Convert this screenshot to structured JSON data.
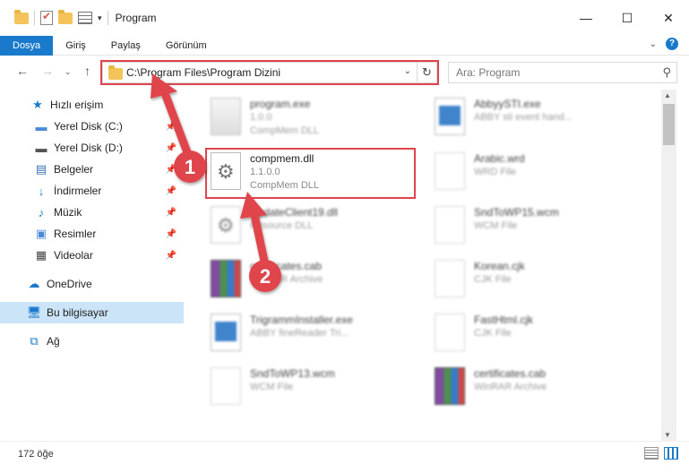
{
  "window": {
    "title": "Program",
    "qa_dropdown_glyph": "▾",
    "minimize": "—",
    "maximize": "☐",
    "close": "✕"
  },
  "ribbon": {
    "tabs": [
      "Dosya",
      "Giriş",
      "Paylaş",
      "Görünüm"
    ],
    "active_tab": "Dosya",
    "help": "?"
  },
  "address": {
    "path": "C:\\Program Files\\Program Dizini",
    "search_placeholder": "Ara: Program"
  },
  "sidebar": {
    "items": [
      {
        "label": "Hızlı erişim",
        "icon": "star-icon",
        "pinned": false
      },
      {
        "label": "Yerel Disk (C:)",
        "icon": "drive-icon",
        "pinned": true
      },
      {
        "label": "Yerel Disk (D:)",
        "icon": "drive-icon",
        "pinned": true
      },
      {
        "label": "Belgeler",
        "icon": "documents-icon",
        "pinned": true
      },
      {
        "label": "İndirmeler",
        "icon": "download-icon",
        "pinned": true
      },
      {
        "label": "Müzik",
        "icon": "music-icon",
        "pinned": true
      },
      {
        "label": "Resimler",
        "icon": "pictures-icon",
        "pinned": true
      },
      {
        "label": "Videolar",
        "icon": "video-icon",
        "pinned": true
      },
      {
        "label": "OneDrive",
        "icon": "cloud-icon",
        "pinned": false
      },
      {
        "label": "Bu bilgisayar",
        "icon": "computer-icon",
        "pinned": false
      },
      {
        "label": "Ağ",
        "icon": "network-icon",
        "pinned": false
      }
    ],
    "selected": "Bu bilgisayar"
  },
  "files": [
    {
      "name": "program.exe",
      "meta1": "1.0.0",
      "meta2": "CompMem DLL",
      "type": "exe",
      "blurred": true
    },
    {
      "name": "AbbyySTI.exe",
      "meta1": "ABBY sti event hand...",
      "meta2": "",
      "type": "exe2",
      "blurred": true
    },
    {
      "name": "compmem.dll",
      "meta1": "1.1.0.0",
      "meta2": "CompMem DLL",
      "type": "dll",
      "blurred": false
    },
    {
      "name": "Arabic.wrd",
      "meta1": "WRD File",
      "meta2": "",
      "type": "doc",
      "blurred": true
    },
    {
      "name": "UpdateClient19.dll",
      "meta1": "Resource DLL",
      "meta2": "",
      "type": "dll",
      "blurred": true
    },
    {
      "name": "SndToWP15.wcm",
      "meta1": "WCM File",
      "meta2": "",
      "type": "doc",
      "blurred": true
    },
    {
      "name": "certificates.cab",
      "meta1": "WinRAR Archive",
      "meta2": "",
      "type": "rar",
      "blurred": true
    },
    {
      "name": "Korean.cjk",
      "meta1": "CJK File",
      "meta2": "",
      "type": "doc",
      "blurred": true
    },
    {
      "name": "TrigrammInstaller.exe",
      "meta1": "ABBY fineReader Tri...",
      "meta2": "",
      "type": "exe2",
      "blurred": true
    },
    {
      "name": "FastHtml.cjk",
      "meta1": "CJK File",
      "meta2": "",
      "type": "doc",
      "blurred": true
    },
    {
      "name": "SndToWP13.wcm",
      "meta1": "WCM File",
      "meta2": "",
      "type": "doc",
      "blurred": true
    },
    {
      "name": "certificates.cab",
      "meta1": "WinRAR Archive",
      "meta2": "",
      "type": "rar",
      "blurred": true
    }
  ],
  "annotations": {
    "step1": "1",
    "step2": "2",
    "color": "#e0444c"
  },
  "status": {
    "count": "172 öğe"
  }
}
